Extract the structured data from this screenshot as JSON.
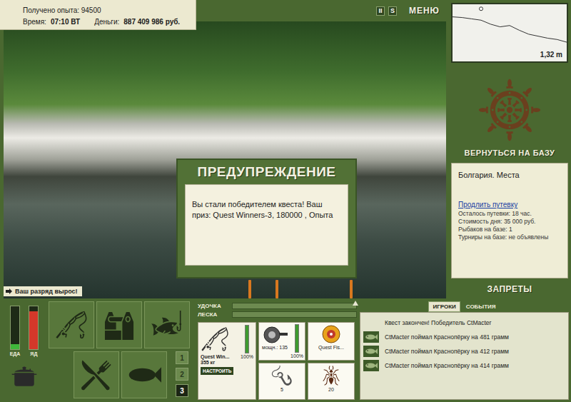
{
  "stats": {
    "experience": "Получено опыта: 94500",
    "time_label": "Время:",
    "time": "07:10 ВТ",
    "money_label": "Деньги:",
    "money": "887 409 986 руб."
  },
  "top_buttons": [
    "II",
    "S"
  ],
  "menu": "МЕНЮ",
  "depth": {
    "reading": "1,32 m",
    "values": [
      0.3,
      0.35,
      0.45,
      0.55,
      0.85,
      1.05,
      0.95,
      1.3,
      1.6,
      1.75,
      1.9,
      2.0,
      2.2
    ],
    "float_index": 3
  },
  "return_button": "ВЕРНУТЬСЯ НА БАЗУ",
  "location": {
    "title": "Болгария. Места",
    "link": "Продлить путевку",
    "lines": [
      "Осталось путевки: 18 час.",
      "Стоимость дня: 35 000 руб.",
      "Рыбаков на базе: 1",
      "Турниры на базе: не объявлены"
    ]
  },
  "bans_button": "ЗАПРЕТЫ",
  "dialog": {
    "title": "ПРЕДУПРЕЖДЕНИЕ",
    "message": "Вы стали победителем квеста! Ваш приз: Quest Winners-3, 180000 , Опыта"
  },
  "notice": "Ваш разряд вырос!",
  "meters": [
    {
      "label": "ЕДА",
      "level": 0.12,
      "color": "#3fb83a"
    },
    {
      "label": "ЯД",
      "level": 0.88,
      "color": "#d4382a"
    }
  ],
  "slots": [
    {
      "number": "1",
      "selected": false
    },
    {
      "number": "2",
      "selected": false
    },
    {
      "number": "3",
      "selected": true
    }
  ],
  "bars": [
    {
      "label": "УДОЧКА",
      "level": 0
    },
    {
      "label": "ЛЕСКА",
      "level": 0
    }
  ],
  "rod": {
    "name": "Quest Win...",
    "strength": "355 кг",
    "button": "НАСТРОИТЬ",
    "condition": "100%",
    "level": 1
  },
  "reel": {
    "power": "мощн.: 135",
    "condition": "100%",
    "level": 1
  },
  "line": {
    "name": "Quest Fis..."
  },
  "hook": {
    "count": "5"
  },
  "bait": {
    "count": "20"
  },
  "chat": {
    "tabs": [
      {
        "label": "ИГРОКИ",
        "selected": true
      },
      {
        "label": "СОБЫТИЯ",
        "selected": false
      }
    ],
    "messages": [
      {
        "text": "Квест закончен! Победитель CtMacter",
        "kind": "plain"
      },
      {
        "text": "CtMacter поймал Краснопёрку на 481 грамм",
        "kind": "catch"
      },
      {
        "text": "CtMacter поймал Краснопёрку на 412 грамм",
        "kind": "catch"
      },
      {
        "text": "CtMacter поймал Краснопёрку на 414 грамм",
        "kind": "catch"
      }
    ]
  }
}
